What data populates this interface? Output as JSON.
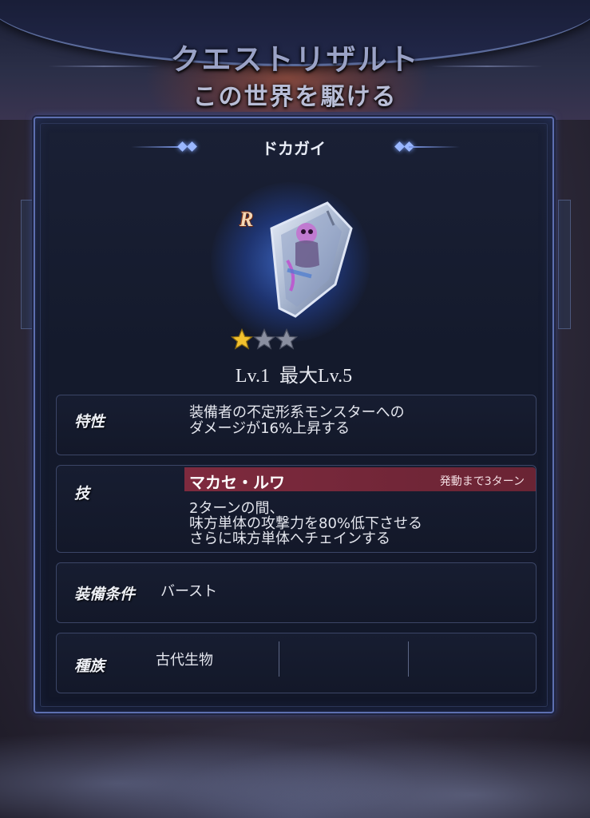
{
  "header": {
    "title": "クエストリザルト",
    "subtitle": "この世界を駆ける"
  },
  "item": {
    "name": "ドカガイ",
    "rarity": "R",
    "stars_filled": 1,
    "stars_total": 3,
    "level_text": "Lv.1",
    "max_level_text": "最大Lv.5"
  },
  "trait": {
    "label": "特性",
    "line1": "装備者の不定形系モンスターへの",
    "line2": "ダメージが16%上昇する"
  },
  "skill": {
    "label": "技",
    "name": "マカセ・ルワ",
    "cooldown": "発動まで3ターン",
    "line1": "2ターンの間、",
    "line2": "味方単体の攻撃力を80%低下させる",
    "line3": "さらに味方単体へチェインする"
  },
  "equip": {
    "label": "装備条件",
    "value": "バースト"
  },
  "race": {
    "label": "種族",
    "value": "古代生物"
  },
  "colors": {
    "panel_border": "#5d6fb0",
    "skill_bar": "#7e2a3e",
    "star_gold": "#f2c12e",
    "star_empty": "#8a8fa0"
  }
}
